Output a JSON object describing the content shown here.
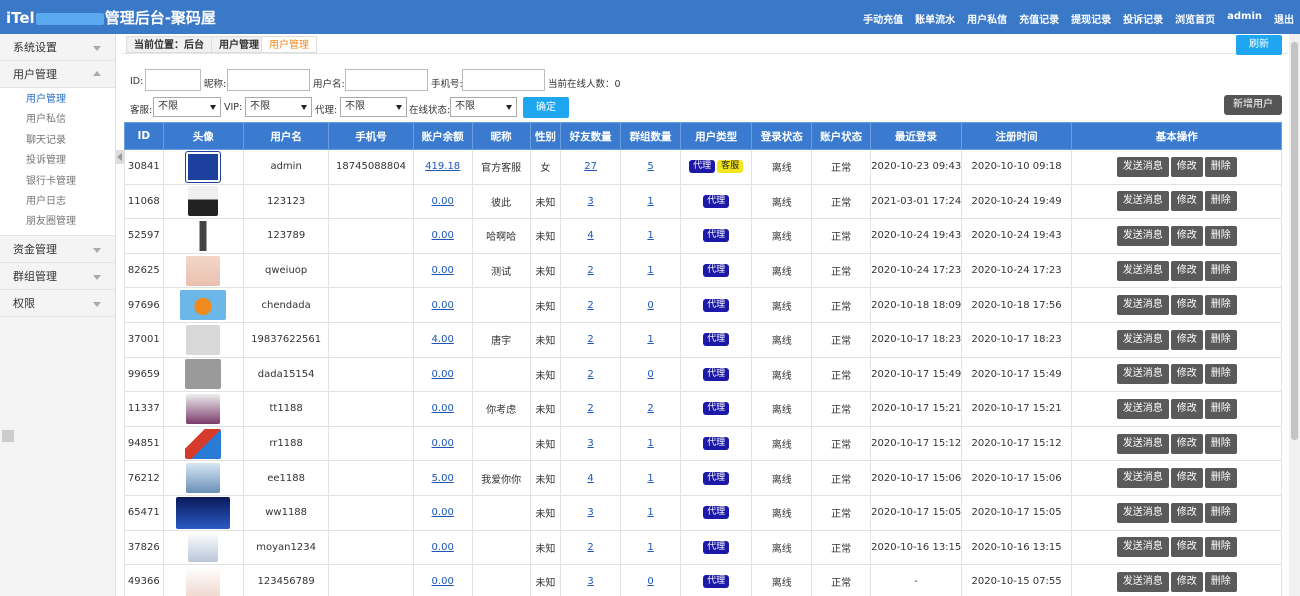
{
  "header": {
    "title_prefix": "iTel",
    "title_suffix": "管理后台-聚码屋",
    "nav": [
      "手动充值",
      "账单流水",
      "用户私信",
      "充值记录",
      "提现记录",
      "投诉记录",
      "浏览首页",
      "admin",
      "退出"
    ]
  },
  "sidebar": {
    "groups": [
      {
        "label": "系统设置"
      },
      {
        "label": "用户管理",
        "items": [
          "用户管理",
          "用户私信",
          "聊天记录",
          "投诉管理",
          "银行卡管理",
          "用户日志",
          "朋友圈管理"
        ]
      },
      {
        "label": "资金管理"
      },
      {
        "label": "群组管理"
      },
      {
        "label": "权限"
      }
    ]
  },
  "breadcrumb": {
    "label": "当前位置：后台",
    "mid": "用户管理",
    "current": "用户管理"
  },
  "refresh_label": "刷新",
  "filters": {
    "id_label": "ID:",
    "nickname_label": "昵称:",
    "username_label": "用户名:",
    "phone_label": "手机号:",
    "online_count_label": "当前在线人数：0",
    "service_label": "客服:",
    "service_value": "不限",
    "vip_label": "VIP:",
    "vip_value": "不限",
    "agent_label": "代理:",
    "agent_value": "不限",
    "online_label": "在线状态:",
    "online_value": "不限",
    "confirm_label": "确定",
    "add_user_label": "新增用户"
  },
  "table": {
    "columns": [
      "ID",
      "头像",
      "用户名",
      "手机号",
      "账户余额",
      "昵称",
      "性别",
      "好友数量",
      "群组数量",
      "用户类型",
      "登录状态",
      "账户状态",
      "最近登录",
      "注册时间",
      "基本操作"
    ],
    "badge_agent": "代理",
    "badge_service": "客服",
    "actions": [
      "发送消息",
      "修改",
      "删除"
    ],
    "rows": [
      {
        "id": "30841",
        "avatar": "itel",
        "username": "admin",
        "phone": "18745088804",
        "balance": "419.18",
        "nickname": "官方客服",
        "gender": "女",
        "friends": "27",
        "groups": "5",
        "service": true,
        "login": "离线",
        "status": "正常",
        "last_login": "2020-10-23 09:43",
        "registered": "2020-10-10 09:18"
      },
      {
        "id": "11068",
        "avatar": "a1",
        "username": "123123",
        "phone": "",
        "balance": "0.00",
        "nickname": "彼此",
        "gender": "未知",
        "friends": "3",
        "groups": "1",
        "service": false,
        "login": "离线",
        "status": "正常",
        "last_login": "2021-03-01 17:24",
        "registered": "2020-10-24 19:49"
      },
      {
        "id": "52597",
        "avatar": "a2",
        "username": "123789",
        "phone": "",
        "balance": "0.00",
        "nickname": "哈啊哈",
        "gender": "未知",
        "friends": "4",
        "groups": "1",
        "service": false,
        "login": "离线",
        "status": "正常",
        "last_login": "2020-10-24 19:43",
        "registered": "2020-10-24 19:43"
      },
      {
        "id": "82625",
        "avatar": "a3",
        "username": "qweiuop",
        "phone": "",
        "balance": "0.00",
        "nickname": "测试",
        "gender": "未知",
        "friends": "2",
        "groups": "1",
        "service": false,
        "login": "离线",
        "status": "正常",
        "last_login": "2020-10-24 17:23",
        "registered": "2020-10-24 17:23"
      },
      {
        "id": "97696",
        "avatar": "a4",
        "username": "chendada",
        "phone": "",
        "balance": "0.00",
        "nickname": "",
        "gender": "未知",
        "friends": "2",
        "groups": "0",
        "service": false,
        "login": "离线",
        "status": "正常",
        "last_login": "2020-10-18 18:09",
        "registered": "2020-10-18 17:56"
      },
      {
        "id": "37001",
        "avatar": "a5",
        "username": "19837622561",
        "phone": "",
        "balance": "4.00",
        "nickname": "唐宇",
        "gender": "未知",
        "friends": "2",
        "groups": "1",
        "service": false,
        "login": "离线",
        "status": "正常",
        "last_login": "2020-10-17 18:23",
        "registered": "2020-10-17 18:23"
      },
      {
        "id": "99659",
        "avatar": "a6",
        "username": "dada15154",
        "phone": "",
        "balance": "0.00",
        "nickname": "",
        "gender": "未知",
        "friends": "2",
        "groups": "0",
        "service": false,
        "login": "离线",
        "status": "正常",
        "last_login": "2020-10-17 15:49",
        "registered": "2020-10-17 15:49"
      },
      {
        "id": "11337",
        "avatar": "a7",
        "username": "tt1188",
        "phone": "",
        "balance": "0.00",
        "nickname": "你考虑",
        "gender": "未知",
        "friends": "2",
        "groups": "2",
        "service": false,
        "login": "离线",
        "status": "正常",
        "last_login": "2020-10-17 15:21",
        "registered": "2020-10-17 15:21"
      },
      {
        "id": "94851",
        "avatar": "a8",
        "username": "rr1188",
        "phone": "",
        "balance": "0.00",
        "nickname": "",
        "gender": "未知",
        "friends": "3",
        "groups": "1",
        "service": false,
        "login": "离线",
        "status": "正常",
        "last_login": "2020-10-17 15:12",
        "registered": "2020-10-17 15:12"
      },
      {
        "id": "76212",
        "avatar": "a9",
        "username": "ee1188",
        "phone": "",
        "balance": "5.00",
        "nickname": "我爱你你",
        "gender": "未知",
        "friends": "4",
        "groups": "1",
        "service": false,
        "login": "离线",
        "status": "正常",
        "last_login": "2020-10-17 15:06",
        "registered": "2020-10-17 15:06"
      },
      {
        "id": "65471",
        "avatar": "a10",
        "username": "ww1188",
        "phone": "",
        "balance": "0.00",
        "nickname": "",
        "gender": "未知",
        "friends": "3",
        "groups": "1",
        "service": false,
        "login": "离线",
        "status": "正常",
        "last_login": "2020-10-17 15:05",
        "registered": "2020-10-17 15:05"
      },
      {
        "id": "37826",
        "avatar": "a11",
        "username": "moyan1234",
        "phone": "",
        "balance": "0.00",
        "nickname": "",
        "gender": "未知",
        "friends": "2",
        "groups": "1",
        "service": false,
        "login": "离线",
        "status": "正常",
        "last_login": "2020-10-16 13:15",
        "registered": "2020-10-16 13:15"
      },
      {
        "id": "49366",
        "avatar": "a12",
        "username": "123456789",
        "phone": "",
        "balance": "0.00",
        "nickname": "",
        "gender": "未知",
        "friends": "3",
        "groups": "0",
        "service": false,
        "login": "离线",
        "status": "正常",
        "last_login": "-",
        "registered": "2020-10-15 07:55"
      }
    ]
  },
  "colors": {
    "header": "#3a78c8",
    "table_header": "#3a7bd0",
    "accent": "#1ea7f0",
    "agent_badge": "#1c18a8",
    "service_badge": "#f3e51e"
  }
}
